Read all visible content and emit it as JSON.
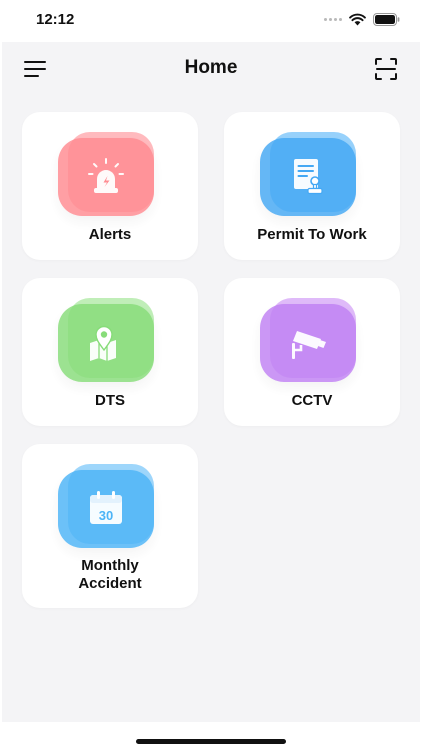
{
  "status_bar": {
    "time": "12:12"
  },
  "header": {
    "title": "Home",
    "menu_icon": "hamburger-menu-icon",
    "scan_icon": "scan-frame-icon"
  },
  "colors": {
    "alerts": "#ff8b91",
    "permit": "#44a8f4",
    "dts": "#87dc79",
    "cctv": "#c081f3",
    "monthly": "#4db4f7",
    "background": "#f4f4f6"
  },
  "cards": [
    {
      "id": "alerts",
      "label": "Alerts",
      "icon": "siren-icon"
    },
    {
      "id": "permit",
      "label": "Permit To Work",
      "icon": "document-stamp-icon"
    },
    {
      "id": "dts",
      "label": "DTS",
      "icon": "map-pin-icon"
    },
    {
      "id": "cctv",
      "label": "CCTV",
      "icon": "cctv-camera-icon"
    },
    {
      "id": "monthly",
      "label_line1": "Monthly",
      "label_line2": "Accident",
      "icon": "calendar-icon",
      "calendar_day": "30"
    }
  ]
}
